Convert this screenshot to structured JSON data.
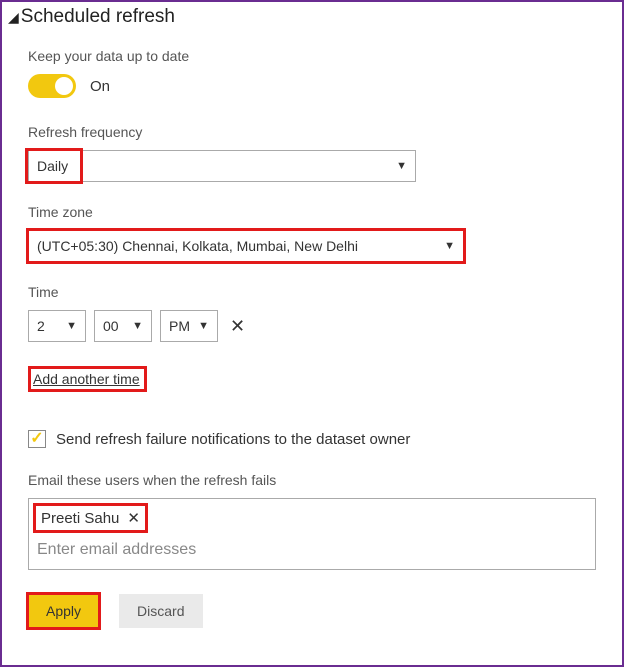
{
  "section_title": "Scheduled refresh",
  "keep_data_label": "Keep your data up to date",
  "toggle": {
    "state": "On"
  },
  "refresh_frequency": {
    "label": "Refresh frequency",
    "value": "Daily"
  },
  "time_zone": {
    "label": "Time zone",
    "value": "(UTC+05:30) Chennai, Kolkata, Mumbai, New Delhi"
  },
  "time": {
    "label": "Time",
    "hour": "2",
    "minute": "00",
    "ampm": "PM"
  },
  "add_another_time": "Add another time",
  "notify_owner_label": "Send refresh failure notifications to the dataset owner",
  "email_users": {
    "label": "Email these users when the refresh fails",
    "chips": [
      "Preeti Sahu"
    ],
    "placeholder": "Enter email addresses"
  },
  "buttons": {
    "apply": "Apply",
    "discard": "Discard"
  }
}
